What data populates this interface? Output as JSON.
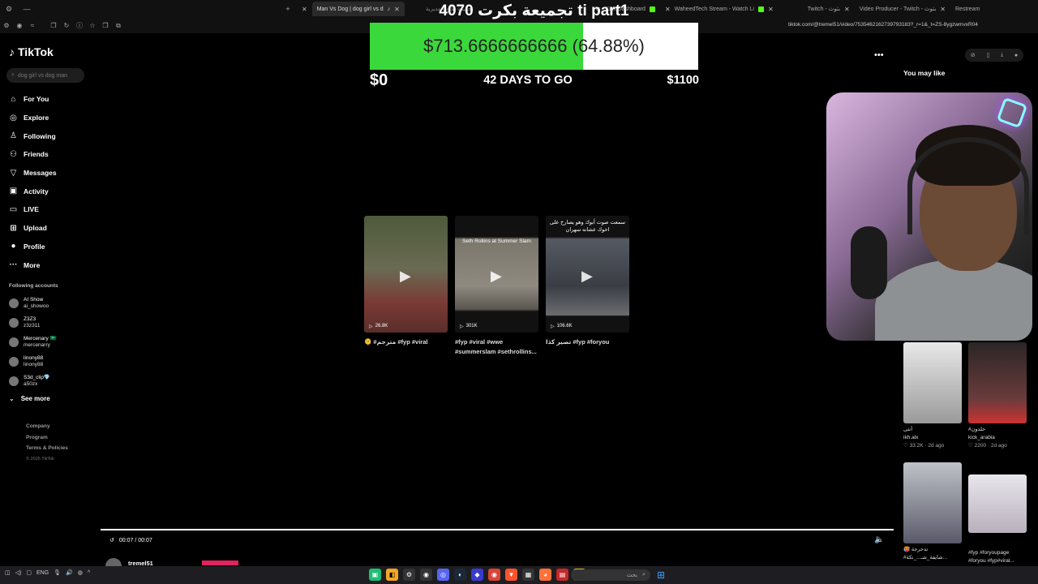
{
  "browser": {
    "tabs": [
      {
        "label": "Man Vs Dog | dog girl vs d",
        "active": true
      },
      {
        "label": "تجميعة بكرت مديرية",
        "active": false
      },
      {
        "label": "ts - Kick Dashboard",
        "active": false
      },
      {
        "label": "WaheedTech Stream - Watch Li",
        "active": false
      },
      {
        "label": "Twitch - بثوث",
        "active": false
      },
      {
        "label": "Video Producer - Twitch - بثوث",
        "active": false
      },
      {
        "label": "Restream",
        "active": false
      }
    ],
    "url": "tiktok.com/@tremel51/video/7535462162739793183?_r=1&_t=ZS-8ygzwmvxR04"
  },
  "tiktok": {
    "logo": "TikTok",
    "search_placeholder": "dog girl vs dog man",
    "nav": [
      {
        "label": "For You",
        "icon": "home-icon"
      },
      {
        "label": "Explore",
        "icon": "compass-icon"
      },
      {
        "label": "Following",
        "icon": "following-icon"
      },
      {
        "label": "Friends",
        "icon": "friends-icon"
      },
      {
        "label": "Messages",
        "icon": "messages-icon"
      },
      {
        "label": "Activity",
        "icon": "activity-icon"
      },
      {
        "label": "LIVE",
        "icon": "live-icon"
      },
      {
        "label": "Upload",
        "icon": "upload-icon"
      },
      {
        "label": "Profile",
        "icon": "profile-icon"
      },
      {
        "label": "More",
        "icon": "more-icon"
      }
    ],
    "following_title": "Following accounts",
    "following": [
      {
        "name": "AI Show",
        "handle": "ai_showoo"
      },
      {
        "name": "Z3Z3",
        "handle": "z3z311"
      },
      {
        "name": "Mercenary 🇸🇦",
        "handle": "mercenarry"
      },
      {
        "name": "linony88",
        "handle": "linony88"
      },
      {
        "name": "S3d_clip💎",
        "handle": "a50zx"
      }
    ],
    "see_more": "See more",
    "footer": [
      "Company",
      "Program",
      "Terms & Policies"
    ],
    "copyright": "© 2025 TikTok"
  },
  "goal": {
    "title": "تجميعة بكرت 4070 ti part1",
    "progress_text": "$713.6666666666 (64.88%)",
    "progress_fraction": 0.6488,
    "min": "$0",
    "days": "42 DAYS TO GO",
    "max": "$1100"
  },
  "videos": [
    {
      "caption_top": "",
      "views": "26.8K",
      "desc": "🫠 #مترجم #fyp #viral",
      "color": "#4e5a3a"
    },
    {
      "caption_top": "Seth Rollins at Summer Slam",
      "views": "301K",
      "desc": "#fyp #viral #wwe #summerslam #sethrollins...",
      "color": "#6b6860"
    },
    {
      "caption_top": "سمعت صوت أبوك وهو يصارخ على اخوك عشانه سهران",
      "views": "106.6K",
      "desc": "تصير كذا #fyp #foryou",
      "color": "#3a3d44"
    }
  ],
  "right": {
    "you_may_like": "You may like",
    "cards": [
      {
        "title": "أنثى",
        "author": "ikh.alx",
        "stats": "♡ 33.2K · 2d ago",
        "color": "#c9c9c9"
      },
      {
        "title": "#خلدون",
        "author": "kick_arabia",
        "stats": "♡ 2200 · 2d ago",
        "color": "#3a3131"
      },
      {
        "title": "🥵 تدحرجة",
        "author": "#شايفة_شـ..._نكة...",
        "stats": "",
        "color": "#6d6a72"
      },
      {
        "title": "#fyp #foryoupage",
        "author": "#foryou #fyp#viral...",
        "stats": "",
        "color": "#d9d6dd"
      }
    ]
  },
  "player": {
    "time": "00:07 / 00:07",
    "username": "tremel51"
  },
  "taskbar": {
    "lang": "ENG",
    "search_placeholder": "بحث"
  }
}
